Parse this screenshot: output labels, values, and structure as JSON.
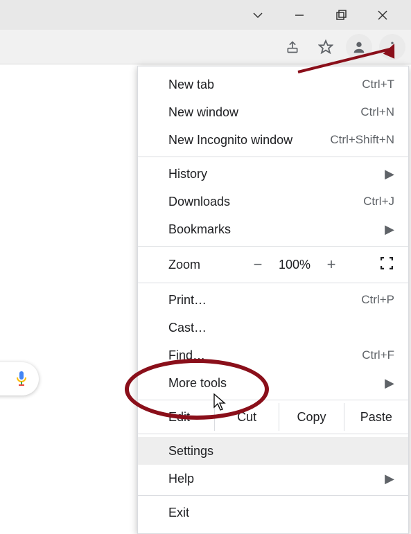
{
  "window": {
    "buttons": [
      "restore-down-icon",
      "minimize-icon",
      "maximize-icon",
      "close-icon"
    ]
  },
  "toolbar": {
    "share_icon": "share-icon",
    "star_icon": "star-icon",
    "profile_icon": "profile-icon",
    "menu_icon": "dots-vertical-icon"
  },
  "menu": {
    "new_tab": {
      "label": "New tab",
      "shortcut": "Ctrl+T"
    },
    "new_window": {
      "label": "New window",
      "shortcut": "Ctrl+N"
    },
    "new_incognito": {
      "label": "New Incognito window",
      "shortcut": "Ctrl+Shift+N"
    },
    "history": {
      "label": "History"
    },
    "downloads": {
      "label": "Downloads",
      "shortcut": "Ctrl+J"
    },
    "bookmarks": {
      "label": "Bookmarks"
    },
    "zoom": {
      "label": "Zoom",
      "minus": "−",
      "value": "100%",
      "plus": "+"
    },
    "print": {
      "label": "Print…",
      "shortcut": "Ctrl+P"
    },
    "cast": {
      "label": "Cast…"
    },
    "find": {
      "label": "Find…",
      "shortcut": "Ctrl+F"
    },
    "more_tools": {
      "label": "More tools"
    },
    "edit": {
      "label": "Edit",
      "cut": "Cut",
      "copy": "Copy",
      "paste": "Paste"
    },
    "settings": {
      "label": "Settings"
    },
    "help": {
      "label": "Help"
    },
    "exit": {
      "label": "Exit"
    }
  },
  "annotation": {
    "highlight": "settings",
    "points_to": "menu-button",
    "color": "#8a0f1a",
    "cursor_on": "settings"
  }
}
